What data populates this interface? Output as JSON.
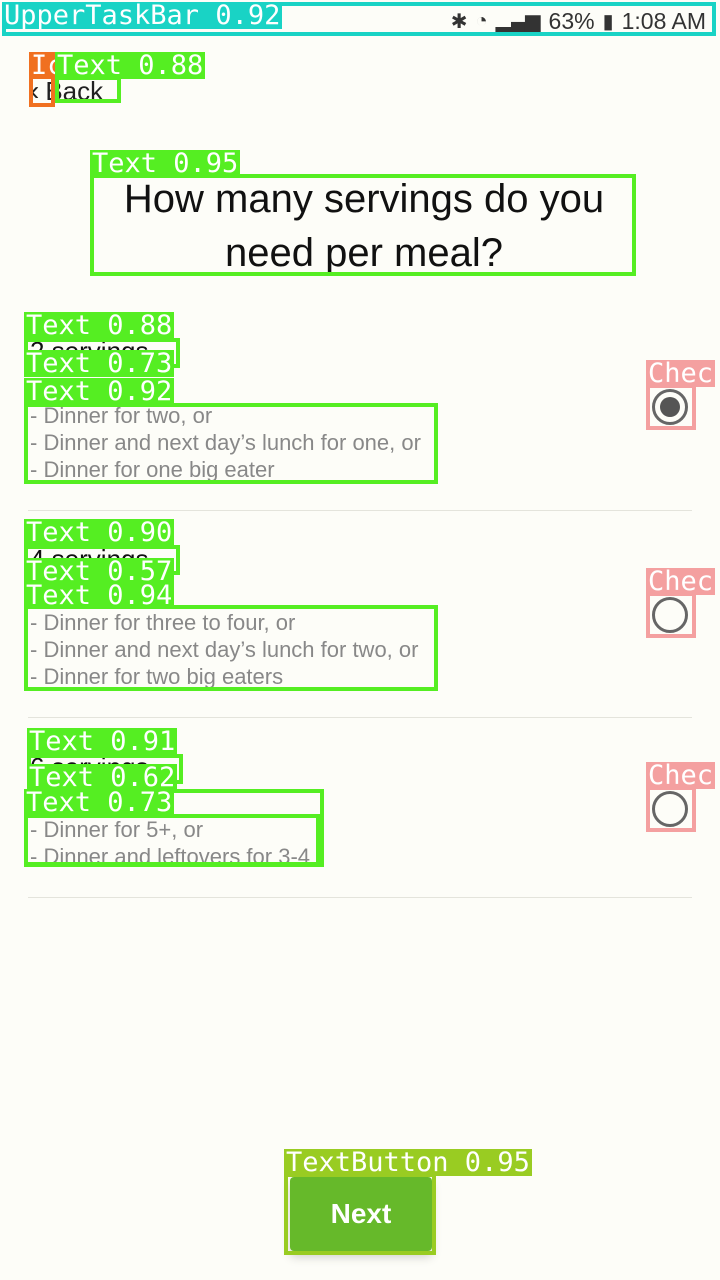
{
  "annotations": {
    "upper_task_bar": "UpperTaskBar 0.92",
    "icon_back": "Ic",
    "text_back": "Text 0.88",
    "text_title": "Text 0.95",
    "text_opt1_title": "Text 0.88",
    "text_opt1_a": "Text 0.73",
    "text_opt1_b": "Text 0.92",
    "text_opt2_title": "Text 0.90",
    "text_opt2_a": "Text 0.57",
    "text_opt2_b": "Text 0.94",
    "text_opt3_title": "Text 0.91",
    "text_opt3_a": "Text 0.62",
    "text_opt3_b": "Text 0.73",
    "check1": "Chec",
    "check2": "Chec",
    "check3": "Chec",
    "next_button": "TextButton 0.95"
  },
  "status_bar": {
    "battery": "63%",
    "time": "1:08 AM"
  },
  "nav": {
    "back_label": "Back"
  },
  "question": "How many servings do you need per meal?",
  "options": [
    {
      "title": "2 servings",
      "lines": [
        "- Dinner for two, or",
        "- Dinner and next day’s lunch for one, or",
        "- Dinner for one big eater"
      ],
      "selected": true
    },
    {
      "title": "4 servings",
      "lines": [
        "- Dinner for three to four, or",
        "- Dinner and next day’s lunch for two, or",
        "- Dinner for two big eaters"
      ],
      "selected": false
    },
    {
      "title": "6 servings",
      "lines": [
        "- Dinner for 5+, or",
        "- Dinner and leftovers for 3-4"
      ],
      "selected": false
    }
  ],
  "next_label": "Next"
}
